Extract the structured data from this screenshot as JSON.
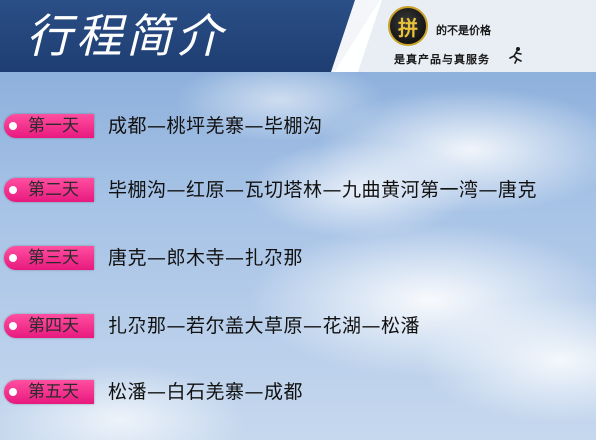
{
  "header": {
    "title": "行程简介",
    "logo": {
      "emblem_char": "拼",
      "slogan_line1": "的不是价格",
      "slogan_line2": "是真产品与真服务"
    }
  },
  "itinerary": {
    "days": [
      {
        "label": "第一天",
        "route": "成都—桃坪羌寨—毕棚沟"
      },
      {
        "label": "第二天",
        "route": "毕棚沟—红原—瓦切塔林—九曲黄河第一湾—唐克"
      },
      {
        "label": "第三天",
        "route": "唐克—郎木寺—扎尕那"
      },
      {
        "label": "第四天",
        "route": "扎尕那—若尔盖大草原—花湖—松潘"
      },
      {
        "label": "第五天",
        "route": "松潘—白石羌寨—成都"
      }
    ]
  },
  "colors": {
    "header_dark": "#1e3e72",
    "badge_pink": "#e8197f",
    "logo_gold": "#e8c23a"
  }
}
